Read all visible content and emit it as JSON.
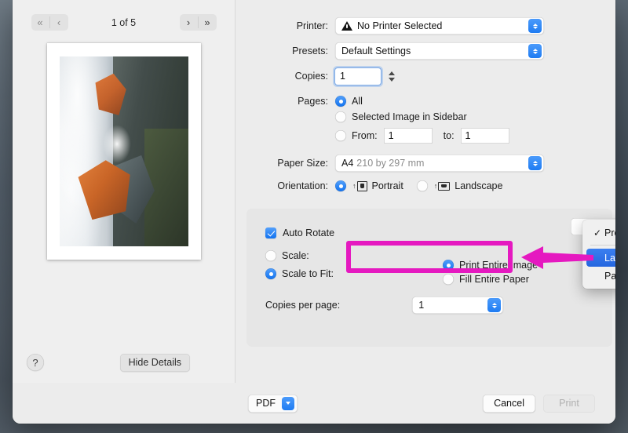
{
  "preview": {
    "nav": {
      "first_icon": "«",
      "prev_icon": "‹",
      "next_icon": "›",
      "last_icon": "»",
      "page_counter": "1 of 5"
    },
    "thumbnail_alt": "mountain-waterfall-photo",
    "help_label": "?",
    "hide_details_label": "Hide Details"
  },
  "settings": {
    "printer": {
      "label": "Printer:",
      "value": "No Printer Selected",
      "has_warning": true
    },
    "presets": {
      "label": "Presets:",
      "value": "Default Settings"
    },
    "copies": {
      "label": "Copies:",
      "value": "1"
    },
    "pages": {
      "label": "Pages:",
      "options": [
        {
          "label": "All",
          "selected": true
        },
        {
          "label": "Selected Image in Sidebar",
          "selected": false
        },
        {
          "label": "From:",
          "selected": false
        }
      ],
      "from_value": "1",
      "to_label": "to:",
      "to_value": "1"
    },
    "paper_size": {
      "label": "Paper Size:",
      "value": "A4",
      "dimensions": "210 by 297 mm"
    },
    "orientation": {
      "label": "Orientation:",
      "portrait_label": "Portrait",
      "portrait_selected": true,
      "landscape_label": "Landscape",
      "landscape_selected": false
    }
  },
  "options_group": {
    "auto_rotate": {
      "label": "Auto Rotate",
      "checked": true
    },
    "scale": {
      "label": "Scale:",
      "selected": false
    },
    "scale_to_fit": {
      "label": "Scale to Fit:",
      "selected": true
    },
    "fit_mode": [
      {
        "label": "Print Entire Image",
        "selected": true
      },
      {
        "label": "Fill Entire Paper",
        "selected": false
      }
    ],
    "copies_per_page": {
      "label": "Copies per page:",
      "value": "1"
    }
  },
  "layout_menu": {
    "items": [
      {
        "label": "Preview",
        "checked": true,
        "selected": false
      },
      {
        "label": "Layout",
        "checked": false,
        "selected": true
      },
      {
        "label": "Paper Handling",
        "checked": false,
        "selected": false
      }
    ],
    "checkmark": "✓"
  },
  "footer": {
    "pdf_label": "PDF",
    "cancel_label": "Cancel",
    "print_label": "Print"
  },
  "annotation": {
    "color": "#e519c0",
    "shape": "left-arrow-and-highlight-box"
  }
}
